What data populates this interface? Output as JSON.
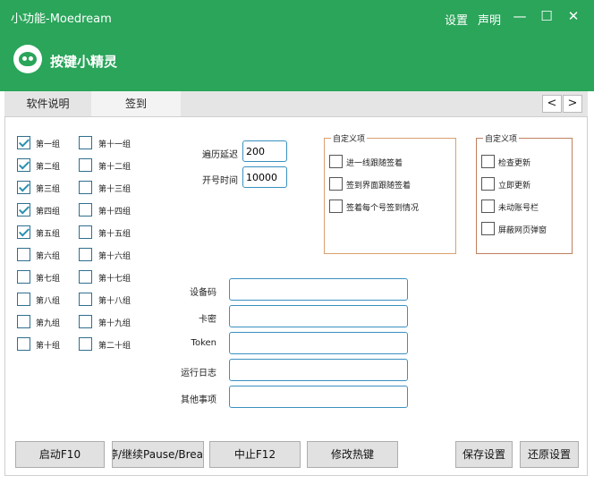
{
  "window": {
    "title": "小功能-Moedream",
    "menu": [
      "设置",
      "声明"
    ],
    "controls": {
      "minimize": "—",
      "maximize": "☐",
      "close": "✕"
    },
    "brand": "按键小精灵"
  },
  "tabs": [
    {
      "label": "软件说明"
    },
    {
      "label": "签到"
    }
  ],
  "nav": {
    "prev": "<",
    "next": ">"
  },
  "groups_left": [
    {
      "label": "第一组",
      "checked": true
    },
    {
      "label": "第二组",
      "checked": true
    },
    {
      "label": "第三组",
      "checked": true
    },
    {
      "label": "第四组",
      "checked": true
    },
    {
      "label": "第五组",
      "checked": true
    },
    {
      "label": "第六组",
      "checked": false
    },
    {
      "label": "第七组",
      "checked": false
    },
    {
      "label": "第八组",
      "checked": false
    },
    {
      "label": "第九组",
      "checked": false
    },
    {
      "label": "第十组",
      "checked": false
    }
  ],
  "groups_right": [
    {
      "label": "第十一组",
      "checked": false
    },
    {
      "label": "第十二组",
      "checked": false
    },
    {
      "label": "第十三组",
      "checked": false
    },
    {
      "label": "第十四组",
      "checked": false
    },
    {
      "label": "第十五组",
      "checked": false
    },
    {
      "label": "第十六组",
      "checked": false
    },
    {
      "label": "第十七组",
      "checked": false
    },
    {
      "label": "第十八组",
      "checked": false
    },
    {
      "label": "第十九组",
      "checked": false
    },
    {
      "label": "第二十组",
      "checked": false
    }
  ],
  "timing": {
    "delay_label": "遍历延迟",
    "delay_value": "200",
    "open_label": "开号时间",
    "open_value": "10000"
  },
  "custom1": {
    "title": "自定义项",
    "options": [
      {
        "label": "进一线跟随签着",
        "checked": false
      },
      {
        "label": "签到界面跟随签着",
        "checked": false
      },
      {
        "label": "签着每个号签到情况",
        "checked": false
      }
    ]
  },
  "custom2": {
    "title": "自定义项",
    "options": [
      {
        "label": "检查更新",
        "checked": false
      },
      {
        "label": "立即更新",
        "checked": false
      },
      {
        "label": "未动账号栏",
        "checked": false
      },
      {
        "label": "屏蔽网页弹窗",
        "checked": false
      }
    ]
  },
  "fields": [
    {
      "label": "设备码",
      "value": ""
    },
    {
      "label": "卡密",
      "value": ""
    },
    {
      "label": "Token",
      "value": ""
    },
    {
      "label": "运行日志",
      "value": ""
    },
    {
      "label": "其他事项",
      "value": ""
    }
  ],
  "buttons": {
    "start": "启动F10",
    "pause": "暂停/继续Pause/Break",
    "stop": "中止F12",
    "hotkey": "修改热键",
    "save": "保存设置",
    "restore": "还原设置"
  },
  "colors": {
    "titlebar": "#2aa55a",
    "accent": "#3a90c0"
  }
}
